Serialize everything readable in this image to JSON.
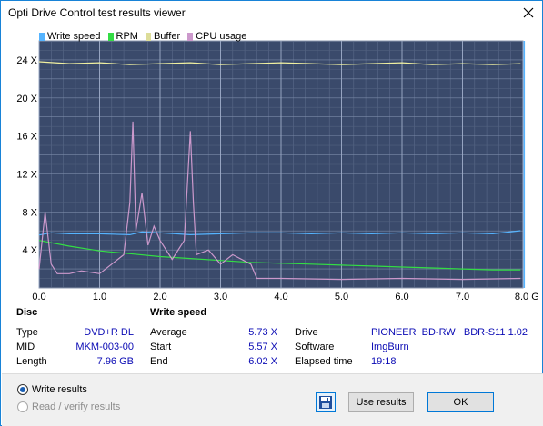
{
  "window": {
    "title": "Opti Drive Control test results viewer"
  },
  "legend": [
    {
      "label": "Write speed",
      "color": "#55b4ff"
    },
    {
      "label": "RPM",
      "color": "#33dd44"
    },
    {
      "label": "Buffer",
      "color": "#dddd99"
    },
    {
      "label": "CPU usage",
      "color": "#cc99cc"
    }
  ],
  "chart_data": {
    "type": "line",
    "x_ticks": [
      "0.0",
      "1.0",
      "2.0",
      "3.0",
      "4.0",
      "5.0",
      "6.0",
      "7.0",
      "8.0 GB"
    ],
    "y_ticks": [
      "4 X",
      "8 X",
      "12 X",
      "16 X",
      "20 X",
      "24 X"
    ],
    "xlim": [
      0,
      8.0
    ],
    "ylim": [
      0,
      26
    ],
    "grid": true,
    "background": "#3a4a6b",
    "series": [
      {
        "name": "Buffer",
        "color": "#f0f0a0",
        "x": [
          0.0,
          0.5,
          1.0,
          1.5,
          2.0,
          2.5,
          3.0,
          3.5,
          4.0,
          4.5,
          5.0,
          5.5,
          6.0,
          6.5,
          7.0,
          7.5,
          7.96
        ],
        "values": [
          23.8,
          23.6,
          23.7,
          23.5,
          23.6,
          23.7,
          23.5,
          23.6,
          23.7,
          23.6,
          23.5,
          23.6,
          23.7,
          23.5,
          23.6,
          23.5,
          23.6
        ]
      },
      {
        "name": "Write speed",
        "color": "#55b4ff",
        "x": [
          0.0,
          0.2,
          0.5,
          1.0,
          1.5,
          1.7,
          2.0,
          2.5,
          3.0,
          3.5,
          4.0,
          4.5,
          5.0,
          5.5,
          6.0,
          6.5,
          7.0,
          7.5,
          7.96
        ],
        "values": [
          5.57,
          5.8,
          5.7,
          5.7,
          5.6,
          5.9,
          5.8,
          5.6,
          5.7,
          5.8,
          5.8,
          5.7,
          5.8,
          5.7,
          5.8,
          5.7,
          5.8,
          5.7,
          6.02
        ]
      },
      {
        "name": "RPM",
        "color": "#33dd44",
        "x": [
          0.0,
          0.5,
          1.0,
          1.5,
          2.0,
          2.5,
          3.0,
          3.5,
          4.0,
          4.5,
          5.0,
          5.5,
          6.0,
          6.5,
          7.0,
          7.5,
          7.96
        ],
        "values": [
          5.0,
          4.4,
          3.9,
          3.6,
          3.3,
          3.1,
          2.9,
          2.7,
          2.6,
          2.5,
          2.4,
          2.3,
          2.2,
          2.1,
          2.0,
          1.9,
          1.9
        ]
      },
      {
        "name": "CPU usage",
        "color": "#cc99cc",
        "x": [
          0.0,
          0.1,
          0.2,
          0.3,
          0.5,
          0.7,
          1.0,
          1.2,
          1.4,
          1.5,
          1.55,
          1.6,
          1.7,
          1.8,
          1.9,
          2.0,
          2.2,
          2.4,
          2.5,
          2.55,
          2.6,
          2.8,
          3.0,
          3.2,
          3.5,
          3.6,
          4.0,
          5.0,
          6.0,
          7.0,
          7.96
        ],
        "values": [
          2.0,
          8.0,
          2.5,
          1.5,
          1.5,
          1.8,
          1.5,
          2.5,
          3.5,
          9.0,
          17.5,
          6.0,
          10.0,
          4.5,
          6.5,
          5.0,
          3.0,
          5.0,
          16.5,
          9.0,
          3.5,
          4.0,
          2.5,
          3.5,
          2.5,
          1.0,
          1.0,
          0.9,
          1.0,
          0.9,
          1.0
        ]
      }
    ]
  },
  "disc": {
    "title": "Disc",
    "rows": [
      {
        "label": "Type",
        "value": "DVD+R DL"
      },
      {
        "label": "MID",
        "value": "MKM-003-00"
      },
      {
        "label": "Length",
        "value": "7.96 GB"
      }
    ]
  },
  "write_speed": {
    "title": "Write speed",
    "rows": [
      {
        "label": "Average",
        "value": "5.73 X"
      },
      {
        "label": "Start",
        "value": "5.57 X"
      },
      {
        "label": "End",
        "value": "6.02 X"
      }
    ]
  },
  "drive_info": {
    "rows": [
      {
        "label": "Drive",
        "value": "PIONEER  BD-RW   BDR-S11 1.02"
      },
      {
        "label": "Software",
        "value": "ImgBurn"
      },
      {
        "label": "Elapsed time",
        "value": "19:18"
      }
    ]
  },
  "options": {
    "write_results": "Write results",
    "read_verify_results": "Read / verify results"
  },
  "buttons": {
    "use_results": "Use results",
    "ok": "OK"
  }
}
